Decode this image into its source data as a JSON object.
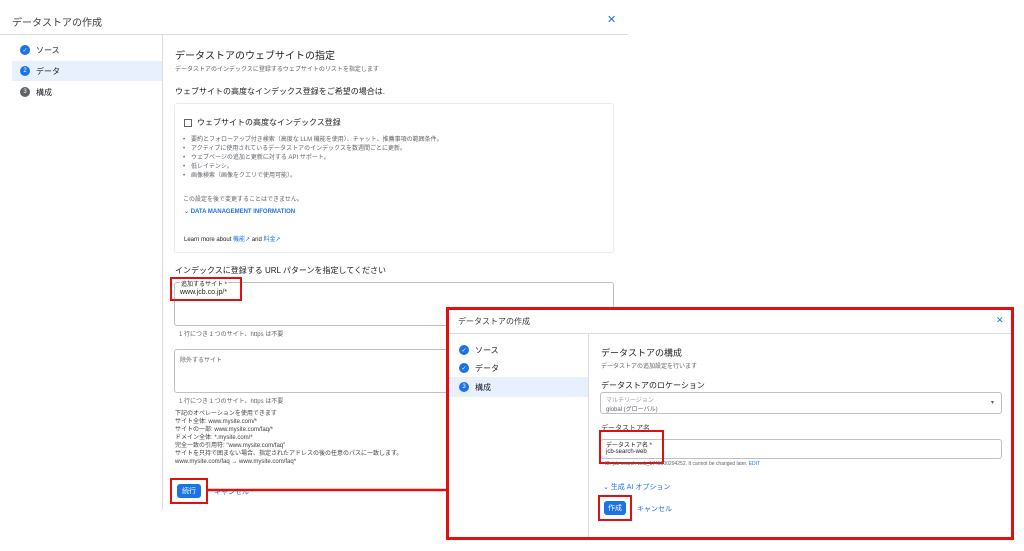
{
  "dialog1": {
    "title": "データストアの作成",
    "steps": [
      {
        "label": "ソース",
        "num": "✓"
      },
      {
        "label": "データ",
        "num": "2"
      },
      {
        "label": "構成",
        "num": "3"
      }
    ],
    "heading": "データストアのウェブサイトの指定",
    "subheading": "データストアのインデックスに登録するウェブサイトのリストを指定します",
    "advanced_prompt": "ウェブサイトの高度なインデックス登録をご希望の場合は.",
    "advanced_checkbox_label": "ウェブサイトの高度なインデックス登録",
    "bullets": [
      "要約とフォローアップ付き検索（高度な LLM 機能を使用）、チャット、推薦事項の範囲条件。",
      "アクティブに使用されているデータストアのインデックスを数週間ごとに更新。",
      "ウェブページの追加と更新に対する API サポート。",
      "低レイテンシ。",
      "画像検索（画像をクエリで使用可能）。"
    ],
    "note": "この設定を後で変更することはできません。",
    "data_mgmt": "DATA MANAGEMENT INFORMATION",
    "learn_more": "Learn more about",
    "learn_link1": "機能",
    "learn_and": "and",
    "learn_link2": "料金",
    "url_pattern_heading": "インデックスに登録する URL パターンを指定してください",
    "add_site_label": "追加するサイト *",
    "add_site_value": "www.jcb.co.jp/*",
    "add_hint": "1 行につき 1 つのサイト、https は不要",
    "exclude_label": "除外するサイト",
    "exclude_hint": "1 行につき 1 つのサイト、https は不要",
    "ops_lines": [
      "下記のオペレーションを使用できます",
      "サイト全体: www.mysite.com/*",
      "サイトの一部: www.mysite.com/faq/*",
      "ドメイン全体: *.mysite.com/*",
      "完全一致の引用符: \"www.mysite.com/faq\"",
      "サイトを只持で囲まない場合、指定されたアドレスの後の任意のパスに一致します。",
      "www.mysite.com/faq → www.mysite.com/faq*"
    ],
    "continue_button": "続行",
    "cancel_partial": "キャンセル"
  },
  "dialog2": {
    "title": "データストアの作成",
    "steps": [
      {
        "label": "ソース",
        "num": "✓"
      },
      {
        "label": "データ",
        "num": "✓"
      },
      {
        "label": "構成",
        "num": "3"
      }
    ],
    "heading": "データストアの構成",
    "subheading": "データストアの追加設定を行います",
    "location_heading": "データストアのロケーション",
    "location_label": "マルチリージョン",
    "location_value": "global (グローバル)",
    "name_heading": "データストア名",
    "name_label": "データストア名 *",
    "name_value": "jcb-search-web",
    "id_hint": "ID: jcb-search-web_1745900294252. It cannot be changed later.",
    "edit_link": "EDIT",
    "genai_options": "生成 AI オプション",
    "create_button": "作成",
    "cancel_button": "キャンセル"
  },
  "colors": {
    "accent": "#1a73e8",
    "highlight": "#e01010"
  }
}
